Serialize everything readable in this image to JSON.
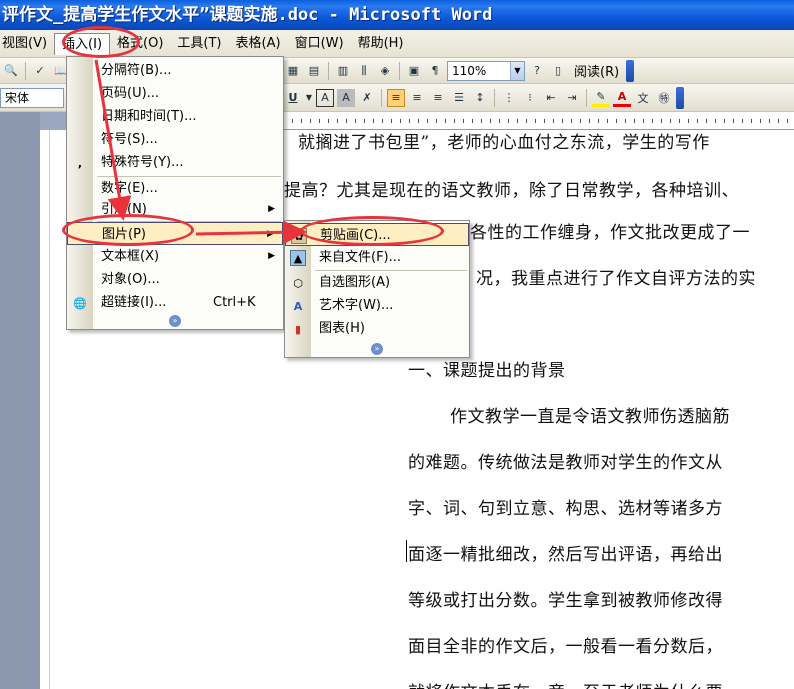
{
  "window": {
    "title": "评作文_提高学生作文水平”课题实施.doc - Microsoft Word"
  },
  "menubar": [
    {
      "label": "视图(V)"
    },
    {
      "label": "插入(I)"
    },
    {
      "label": "格式(O)"
    },
    {
      "label": "工具(T)"
    },
    {
      "label": "表格(A)"
    },
    {
      "label": "窗口(W)"
    },
    {
      "label": "帮助(H)"
    }
  ],
  "toolbar": {
    "zoom": "110%",
    "reading_label": "阅读(R)",
    "font_partial": "宋体"
  },
  "insert_menu": [
    {
      "label": "分隔符(B)..."
    },
    {
      "label": "页码(U)..."
    },
    {
      "label": "日期和时间(T)..."
    },
    {
      "label": "符号(S)..."
    },
    {
      "label": "特殊符号(Y)..."
    },
    {
      "label": "数字(E)..."
    },
    {
      "label": "引用(N)"
    },
    {
      "label": "图片(P)"
    },
    {
      "label": "文本框(X)"
    },
    {
      "label": "对象(O)..."
    },
    {
      "label": "超链接(I)...",
      "shortcut": "Ctrl+K"
    }
  ],
  "picture_menu": [
    {
      "label": "剪贴画(C)..."
    },
    {
      "label": "来自文件(F)..."
    },
    {
      "label": "自选图形(A)"
    },
    {
      "label": "艺术字(W)..."
    },
    {
      "label": "图表(H)"
    }
  ],
  "document": {
    "lines": [
      "就搁进了书包里”，老师的心血付之东流，学生的写作",
      "提高？尤其是现在的语文教师，除了日常教学，各种培训、",
      "各性的工作缠身，作文批改更成了一",
      "况，我重点进行了作文自评方法的实",
      "一、课题提出的背景",
      "作文教学一直是令语文教师伤透脑筋",
      "的难题。传统做法是教师对学生的作文从",
      "字、词、句到立意、构思、选材等诸多方",
      "面逐一精批细改，然后写出评语，再给出",
      "等级或打出分数。学生拿到被教师修改得",
      "面目全非的作文后，一般看一看分数后，",
      "就将作文本丢在一旁，至于老师为什么要"
    ]
  },
  "colors": {
    "titlebar": "#0c58d6",
    "annotation": "#e8333d",
    "highlight": "#ffeec2"
  }
}
